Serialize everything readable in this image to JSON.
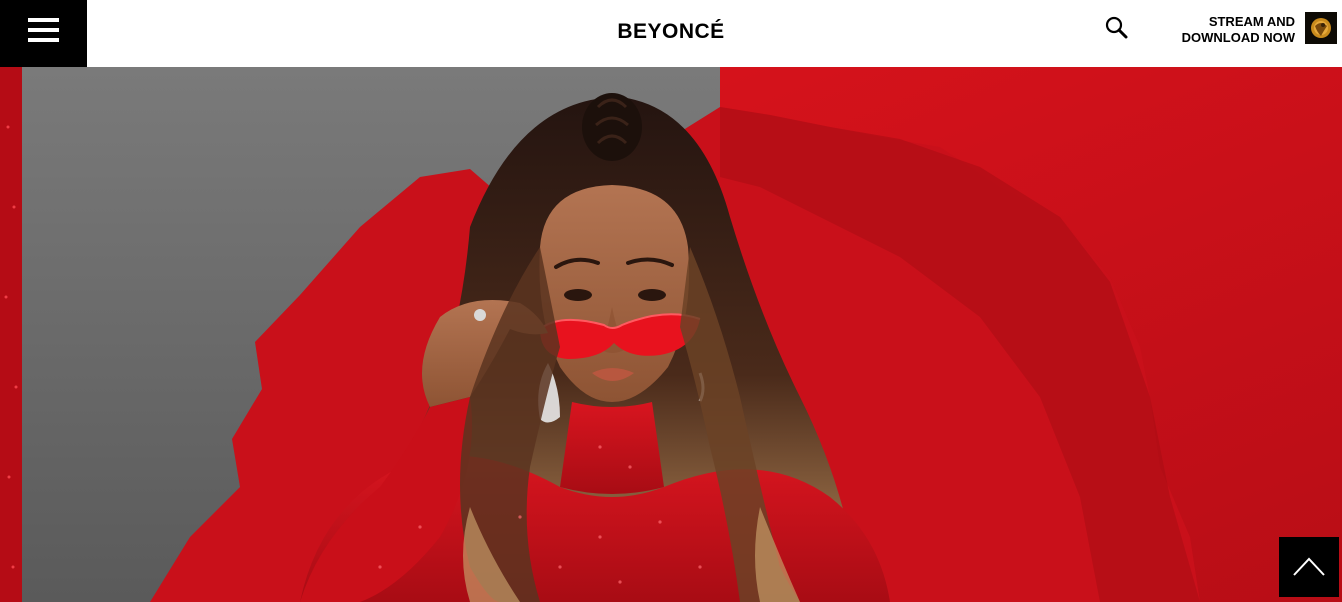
{
  "header": {
    "brand": "BEYONCÉ",
    "menu_icon": "hamburger-menu-icon",
    "search_icon": "search-icon",
    "stream_cta_line1": "STREAM AND",
    "stream_cta_line2": "DOWNLOAD NOW",
    "album_icon": "album-cover-thumbnail"
  },
  "hero": {
    "image": "beyonce-red-sequin-sunglasses-photo",
    "colors": {
      "red": "#d4131c",
      "gray": "#6e6e6e",
      "black": "#000000"
    }
  },
  "scroll_top": {
    "icon": "chevron-up-icon"
  }
}
